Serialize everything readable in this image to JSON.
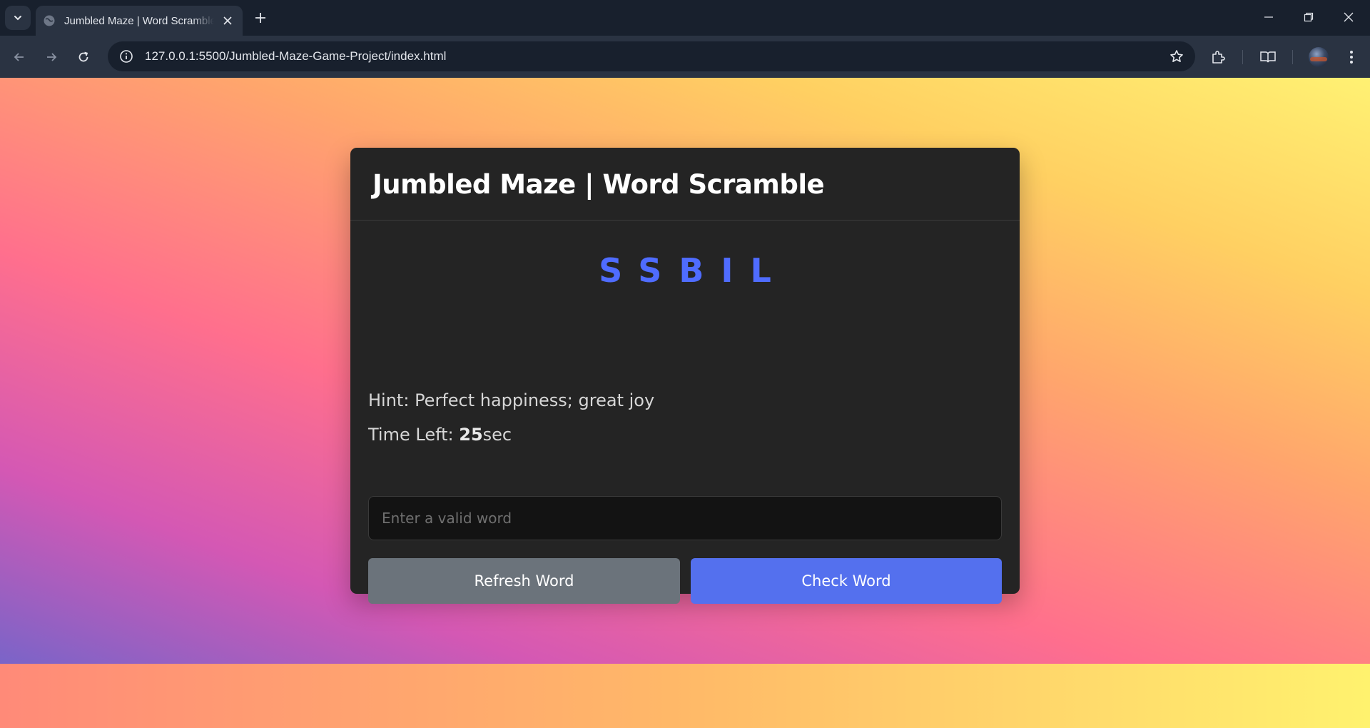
{
  "browser": {
    "tab_title": "Jumbled Maze | Word Scramble",
    "url": "127.0.0.1:5500/Jumbled-Maze-Game-Project/index.html"
  },
  "game": {
    "title": "Jumbled Maze | Word Scramble",
    "scrambled_word": "SSBIL",
    "hint_label": "Hint:",
    "hint_text": "Perfect happiness; great joy",
    "time_label": "Time Left:",
    "time_value": "25",
    "time_unit": "sec",
    "input_placeholder": "Enter a valid word",
    "refresh_label": "Refresh Word",
    "check_label": "Check Word"
  },
  "colors": {
    "accent": "#5470ee",
    "letters": "#4f6cff",
    "secondary_button": "#6b737b",
    "card_background": "#242424"
  }
}
